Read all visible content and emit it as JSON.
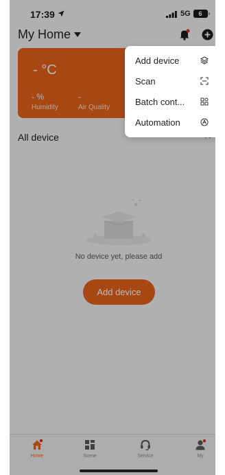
{
  "status": {
    "time": "17:39",
    "network": "5G",
    "battery": "6"
  },
  "header": {
    "title": "My Home"
  },
  "weather": {
    "temperature": "- °C",
    "humidity_value": "- %",
    "humidity_label": "Humidity",
    "air_quality_value": "-",
    "air_quality_label": "Air Quality"
  },
  "devices": {
    "section_title": "All device",
    "more_label": "• •",
    "empty_text": "No device yet, please add",
    "add_button_label": "Add device"
  },
  "menu": {
    "items": [
      {
        "label": "Add device",
        "icon": "cube-icon"
      },
      {
        "label": "Scan",
        "icon": "scan-icon"
      },
      {
        "label": "Batch cont...",
        "icon": "grid-icon"
      },
      {
        "label": "Automation",
        "icon": "automation-icon"
      }
    ]
  },
  "tabs": [
    {
      "label": "Home",
      "icon": "home-icon",
      "active": true,
      "badge": true
    },
    {
      "label": "Scene",
      "icon": "scene-icon",
      "active": false,
      "badge": false
    },
    {
      "label": "Service",
      "icon": "headset-icon",
      "active": false,
      "badge": false
    },
    {
      "label": "My",
      "icon": "person-icon",
      "active": false,
      "badge": true
    }
  ],
  "colors": {
    "accent": "#e8651d",
    "badge": "#e0262b",
    "dim": "rgba(0,0,0,0.28)"
  }
}
